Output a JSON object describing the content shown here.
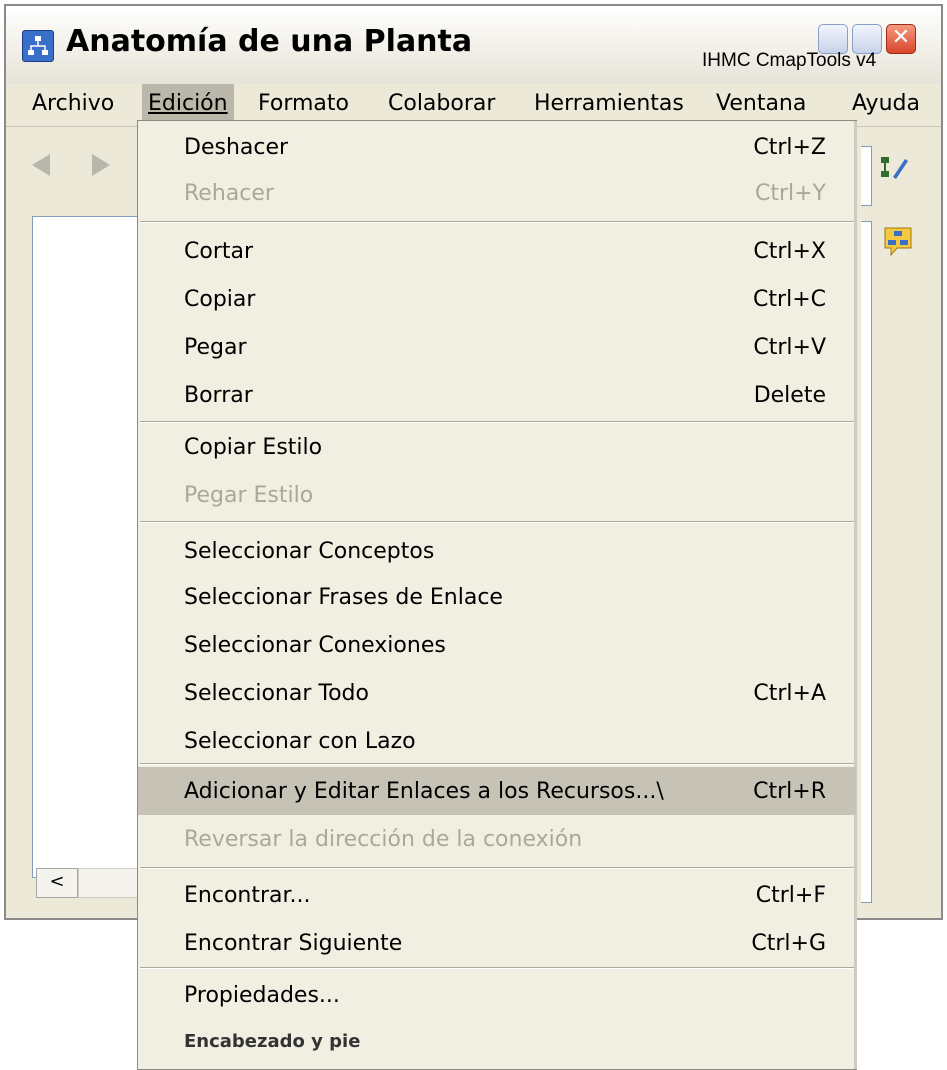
{
  "window": {
    "title": "Anatomía de una Planta",
    "subtitle": "IHMC CmapTools v4",
    "close_glyph": "✕"
  },
  "menubar": {
    "items": [
      {
        "label": "Archivo",
        "mnemonic_index": -1
      },
      {
        "label": "Edición",
        "mnemonic_index": 0
      },
      {
        "label": "Formato",
        "mnemonic_index": 1
      },
      {
        "label": "Colaborar",
        "mnemonic_index": 0
      },
      {
        "label": "Herramientas",
        "mnemonic_index": 10
      },
      {
        "label": "Ventana",
        "mnemonic_index": -1
      },
      {
        "label": "Ayuda",
        "mnemonic_index": -1
      }
    ],
    "active": "Edición"
  },
  "scroll": {
    "left_glyph": "<"
  },
  "edit_menu": {
    "items": [
      {
        "label": "Deshacer",
        "shortcut": "Ctrl+Z",
        "enabled": true
      },
      {
        "label": "Rehacer",
        "shortcut": "Ctrl+Y",
        "enabled": false
      },
      {
        "label": "Cortar",
        "shortcut": "Ctrl+X",
        "enabled": true
      },
      {
        "label": "Copiar",
        "shortcut": "Ctrl+C",
        "enabled": true
      },
      {
        "label": "Pegar",
        "shortcut": "Ctrl+V",
        "enabled": true
      },
      {
        "label": "Borrar",
        "shortcut": "Delete",
        "enabled": true
      },
      {
        "label": "Copiar Estilo",
        "shortcut": "",
        "enabled": true
      },
      {
        "label": "Pegar Estilo",
        "shortcut": "",
        "enabled": false
      },
      {
        "label": "Seleccionar Conceptos",
        "shortcut": "",
        "enabled": true
      },
      {
        "label": "Seleccionar Frases de Enlace",
        "shortcut": "",
        "enabled": true
      },
      {
        "label": "Seleccionar Conexiones",
        "shortcut": "",
        "enabled": true
      },
      {
        "label": "Seleccionar Todo",
        "shortcut": "Ctrl+A",
        "enabled": true
      },
      {
        "label": "Seleccionar con Lazo",
        "shortcut": "",
        "enabled": true
      },
      {
        "label": "Adicionar y Editar Enlaces a los Recursos...\\",
        "shortcut": "Ctrl+R",
        "enabled": true,
        "highlighted": true
      },
      {
        "label": "Reversar la dirección de la conexión",
        "shortcut": "",
        "enabled": false
      },
      {
        "label": "Encontrar...",
        "shortcut": "Ctrl+F",
        "enabled": true
      },
      {
        "label": "Encontrar Siguiente",
        "shortcut": "Ctrl+G",
        "enabled": true
      },
      {
        "label": "Propiedades...",
        "shortcut": "",
        "enabled": true
      },
      {
        "label": "Encabezado y  pie",
        "shortcut": "",
        "enabled": true
      }
    ]
  },
  "icons": {
    "app": "cmap-app-icon",
    "back": "back-arrow-icon",
    "forward": "forward-arrow-icon",
    "edit_map": "edit-map-icon",
    "discussion": "discussion-icon"
  },
  "colors": {
    "highlight": "#c6c3b6",
    "disabled_text": "#aca899",
    "menu_bg": "#f1efe2"
  }
}
